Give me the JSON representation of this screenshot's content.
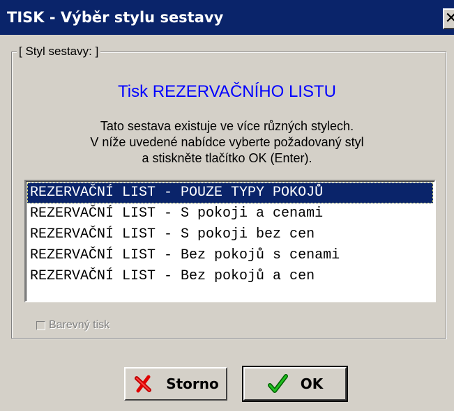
{
  "window": {
    "title": "TISK - Výběr stylu sestavy",
    "close_label": "✕"
  },
  "group": {
    "legend": "[ Styl sestavy: ]",
    "heading": "Tisk REZERVAČNÍHO LISTU",
    "description_lines": [
      "Tato sestava existuje ve více různých stylech.",
      "V níže uvedené nabídce vyberte požadovaný styl",
      "a stiskněte tlačítko OK (Enter)."
    ]
  },
  "list": {
    "items": [
      "REZERVAČNÍ LIST - POUZE TYPY POKOJŮ",
      "REZERVAČNÍ LIST - S pokoji a cenami",
      "REZERVAČNÍ LIST - S pokoji bez cen",
      "REZERVAČNÍ LIST - Bez pokojů s cenami",
      "REZERVAČNÍ LIST - Bez pokojů a cen"
    ],
    "selected_index": 0
  },
  "color_print": {
    "label": "Barevný tisk",
    "checked": false,
    "enabled": false
  },
  "buttons": {
    "cancel_label": "Storno",
    "cancel_icon": "red-x-icon",
    "ok_label": "OK",
    "ok_icon": "green-check-icon"
  },
  "colors": {
    "titlebar": "#0a246a",
    "heading": "#0000ff",
    "selection": "#0a246a",
    "dialog": "#d4d0c8"
  }
}
